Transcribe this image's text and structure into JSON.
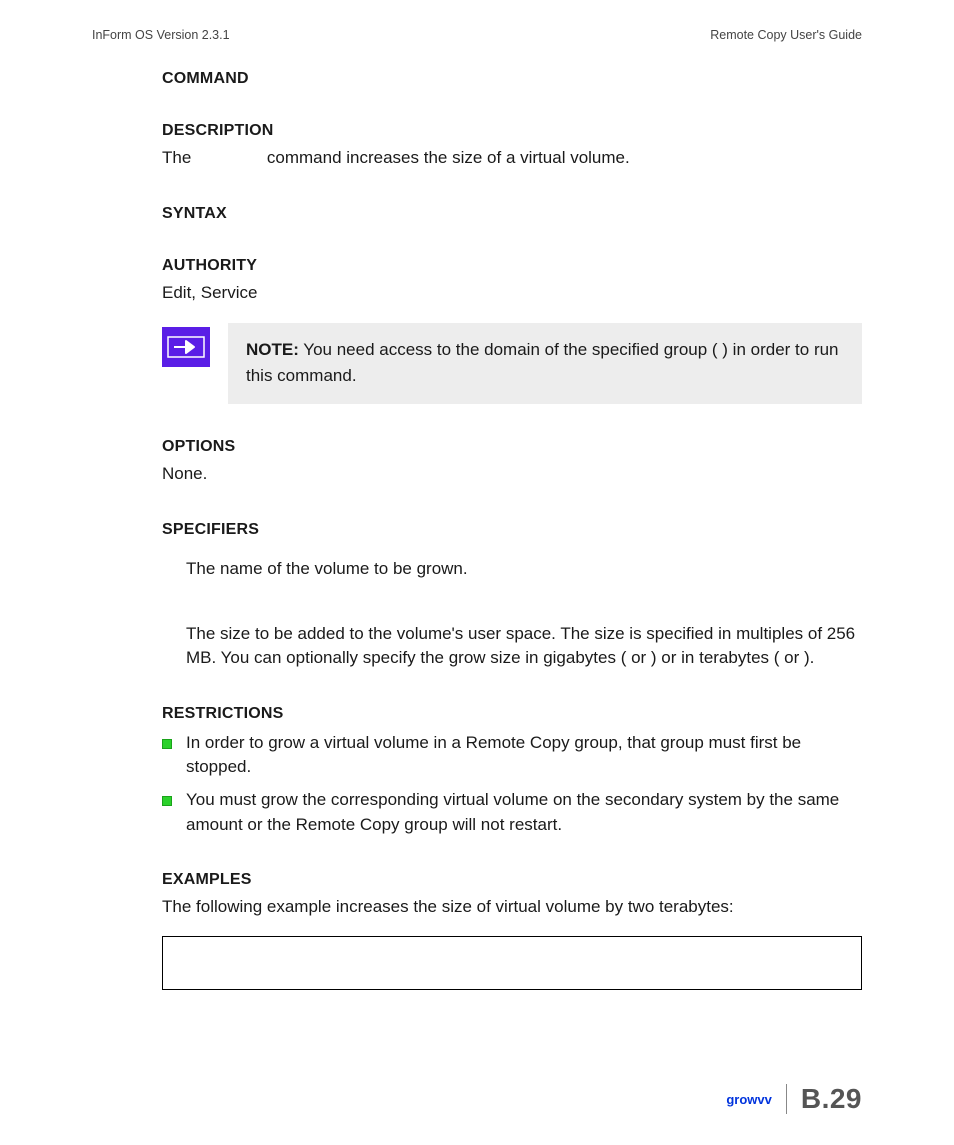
{
  "header": {
    "left": "InForm OS Version 2.3.1",
    "right": "Remote Copy User's Guide"
  },
  "sections": {
    "command_head": "COMMAND",
    "description_head": "DESCRIPTION",
    "description_body_pre": "The ",
    "description_body_post": " command increases the size of a virtual volume.",
    "syntax_head": "SYNTAX",
    "authority_head": "AUTHORITY",
    "authority_body": "Edit, Service",
    "note_label": "NOTE:",
    "note_body": " You need access to the domain of the specified group (                             ) in order to run this command.",
    "options_head": "OPTIONS",
    "options_body": "None.",
    "specifiers_head": "SPECIFIERS",
    "spec1": "The name of the volume to be grown.",
    "spec2": "The size to be added to the volume's user space. The size is specified in multiples of 256 MB. You can optionally specify the grow size in gigabytes (   or   ) or in terabytes (   or   ).",
    "restrictions_head": "RESTRICTIONS",
    "restriction1": "In order to grow a virtual volume in a Remote Copy group, that group must first be stopped.",
    "restriction2": "You must grow the corresponding virtual volume on the secondary system by the same amount or the Remote Copy group will not restart.",
    "examples_head": "EXAMPLES",
    "examples_body": "The following example increases the size of virtual volume          by two terabytes:"
  },
  "footer": {
    "cmd": "growvv",
    "page": "B.29"
  }
}
